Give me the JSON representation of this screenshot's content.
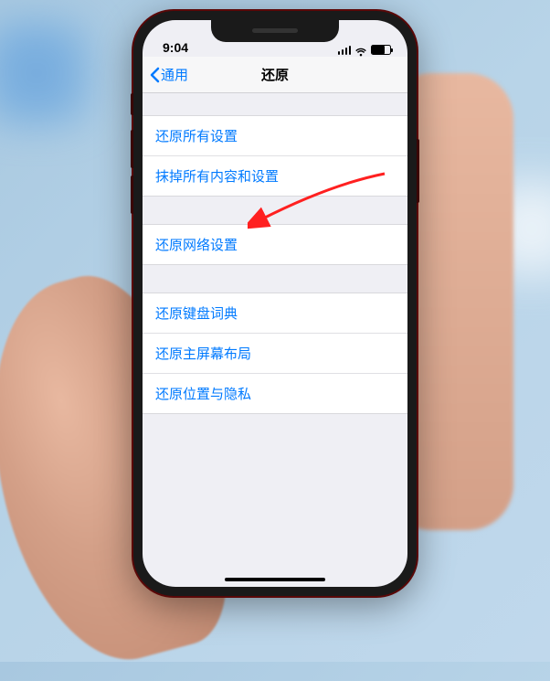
{
  "status": {
    "time": "9:04"
  },
  "nav": {
    "back_label": "通用",
    "title": "还原"
  },
  "group1": {
    "item1": "还原所有设置",
    "item2": "抹掉所有内容和设置"
  },
  "group2": {
    "item1": "还原网络设置"
  },
  "group3": {
    "item1": "还原键盘词典",
    "item2": "还原主屏幕布局",
    "item3": "还原位置与隐私"
  }
}
